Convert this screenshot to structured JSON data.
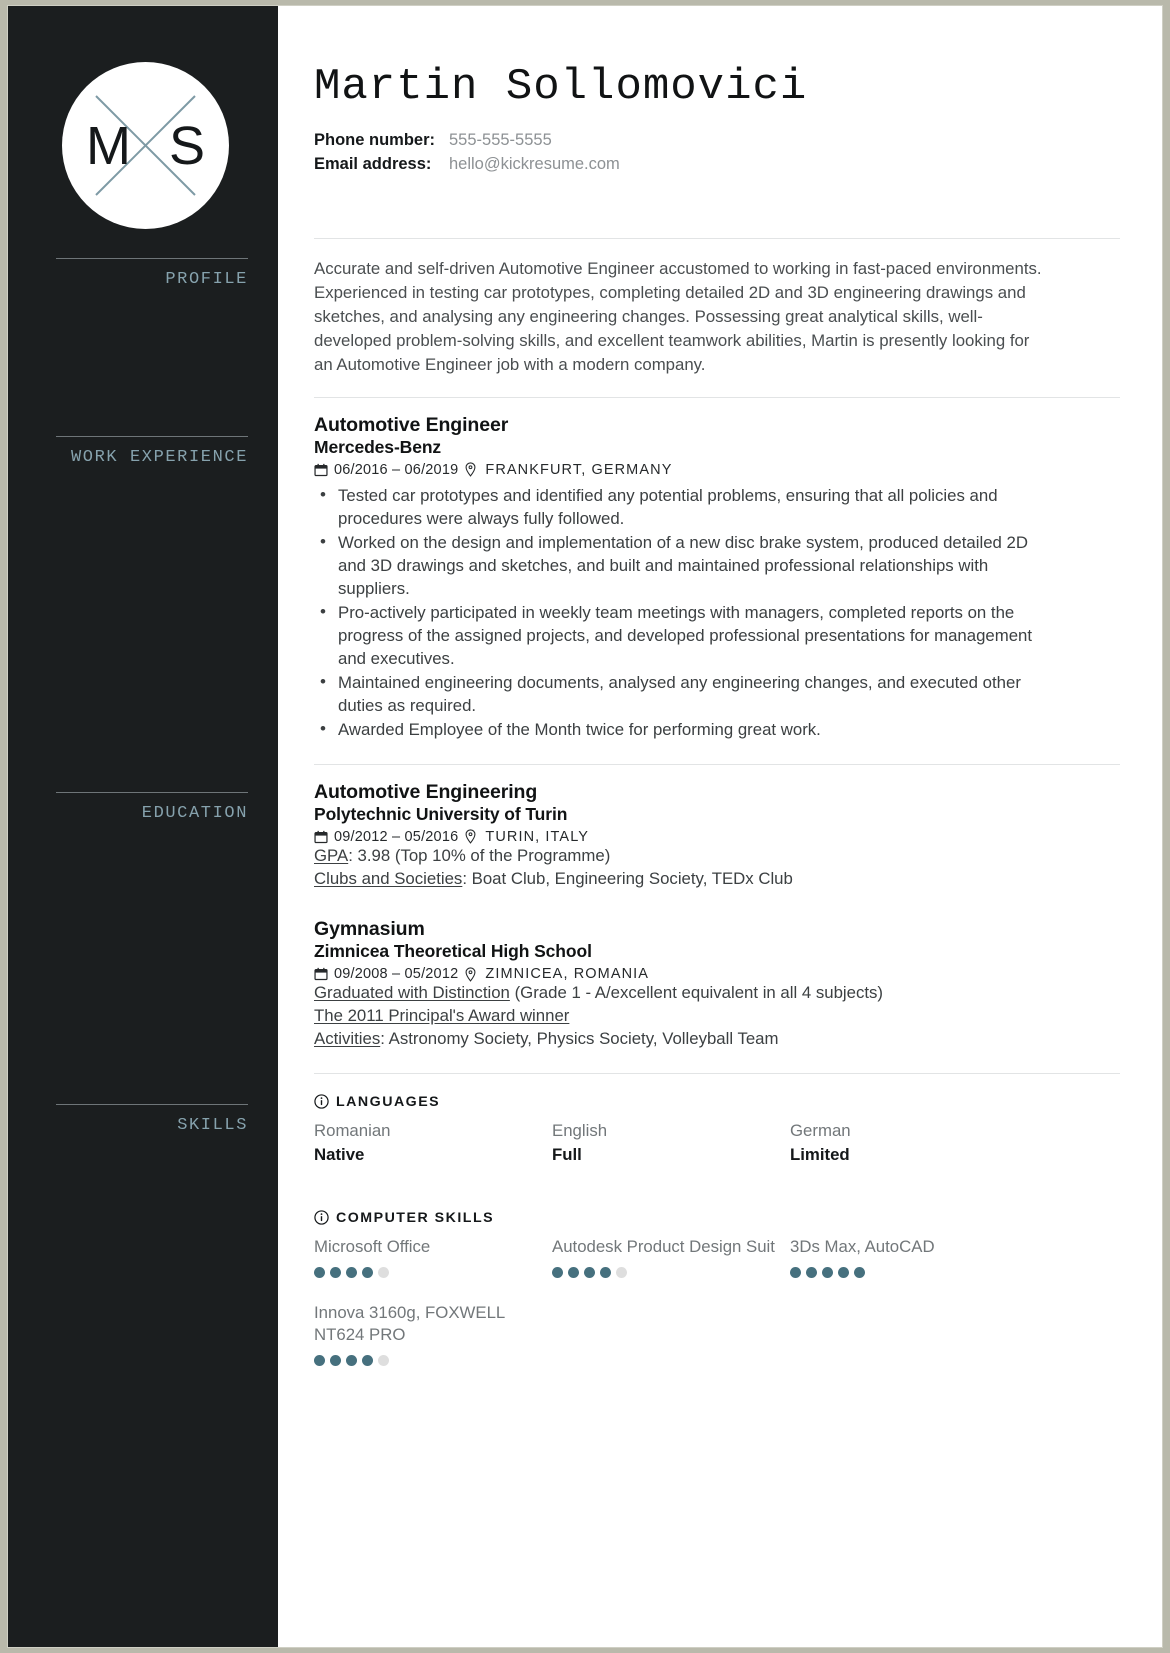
{
  "sidebar": {
    "logo": {
      "left_letter": "M",
      "right_letter": "S"
    },
    "sections": [
      {
        "label": "PROFILE"
      },
      {
        "label": "WORK EXPERIENCE"
      },
      {
        "label": "EDUCATION"
      },
      {
        "label": "SKILLS"
      }
    ]
  },
  "header": {
    "name": "Martin Sollomovici",
    "phone_label": "Phone number:",
    "phone_value": "555-555-5555",
    "email_label": "Email address:",
    "email_value": "hello@kickresume.com"
  },
  "profile": {
    "text": "Accurate and self-driven Automotive Engineer accustomed to working in fast-paced environments. Experienced in testing car prototypes, completing detailed 2D and 3D engineering drawings and sketches, and analysing any engineering changes. Possessing great analytical skills, well-developed problem-solving skills, and excellent teamwork abilities, Martin is presently looking for an Automotive Engineer job with a modern company."
  },
  "work": {
    "title": "Automotive Engineer",
    "company": "Mercedes-Benz",
    "dates": "06/2016 – 06/2019",
    "location": "FRANKFURT, GERMANY",
    "bullets": [
      "Tested car prototypes and identified any potential problems, ensuring that all policies and procedures were always fully followed.",
      "Worked on the design and implementation of a new disc brake system, produced detailed 2D and 3D drawings and sketches, and built and maintained professional relationships with suppliers.",
      "Pro-actively participated in weekly team meetings with managers, completed reports on the progress of the assigned projects, and developed professional presentations for management and executives.",
      "Maintained engineering documents, analysed any engineering changes, and executed other duties as required.",
      "Awarded Employee of the Month twice for performing great work."
    ]
  },
  "education": [
    {
      "title": "Automotive Engineering",
      "school": "Polytechnic University of Turin",
      "dates": "09/2012 – 05/2016",
      "location": "TURIN, ITALY",
      "details": [
        {
          "label": "GPA",
          "sep": ": ",
          "value": "3.98 (Top 10% of the Programme)"
        },
        {
          "label": "Clubs and Societies",
          "sep": ": ",
          "value": "Boat Club, Engineering Society, TEDx Club"
        }
      ]
    },
    {
      "title": "Gymnasium",
      "school": "Zimnicea Theoretical High School",
      "dates": "09/2008 – 05/2012",
      "location": "ZIMNICEA, ROMANIA",
      "details": [
        {
          "label": "Graduated with Distinction",
          "sep": " ",
          "value": "(Grade 1 - A/excellent equivalent in all 4 subjects)"
        },
        {
          "label": "The 2011 Principal's Award winner",
          "sep": "",
          "value": ""
        },
        {
          "label": "Activities",
          "sep": ": ",
          "value": "Astronomy Society, Physics Society, Volleyball Team"
        }
      ]
    }
  ],
  "languages": {
    "heading": "LANGUAGES",
    "items": [
      {
        "name": "Romanian",
        "level": "Native"
      },
      {
        "name": "English",
        "level": "Full"
      },
      {
        "name": "German",
        "level": "Limited"
      }
    ]
  },
  "computer_skills": {
    "heading": "COMPUTER SKILLS",
    "max_dots": 5,
    "items": [
      {
        "name": "Microsoft Office",
        "rating": 4
      },
      {
        "name": "Autodesk Product Design Suit",
        "rating": 4
      },
      {
        "name": "3Ds Max, AutoCAD",
        "rating": 5
      },
      {
        "name": "Innova 3160g, FOXWELL NT624 PRO",
        "rating": 4
      }
    ]
  },
  "colors": {
    "sidebar_bg": "#1b1e1f",
    "sidebar_label": "#86a2ad",
    "dot_filled": "#46707e",
    "dot_empty": "#dedede",
    "page_bg": "#b9b9ab"
  },
  "icons": {
    "calendar": "calendar-icon",
    "location": "location-pin-icon",
    "info": "info-circle-icon"
  }
}
